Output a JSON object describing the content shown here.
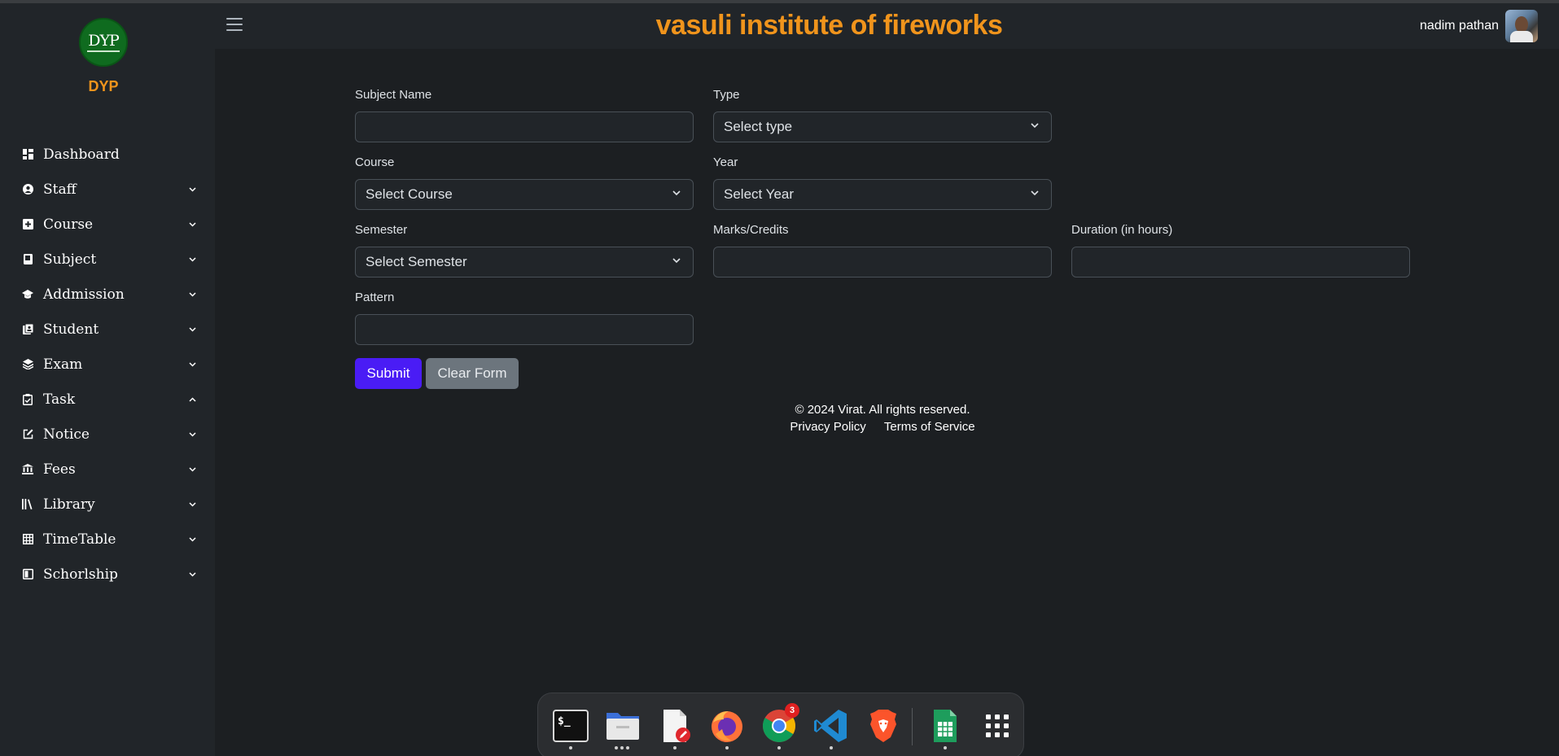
{
  "brand": {
    "logo_text": "DYP",
    "name": "DYP"
  },
  "header": {
    "site_title": "vasuli institute of fireworks",
    "user_name": "nadim pathan"
  },
  "sidebar": {
    "items": [
      {
        "label": "Dashboard",
        "icon": "dashboard-icon",
        "caret": ""
      },
      {
        "label": "Staff",
        "icon": "person-icon",
        "caret": "down"
      },
      {
        "label": "Course",
        "icon": "plus-square-icon",
        "caret": "down"
      },
      {
        "label": "Subject",
        "icon": "book-icon",
        "caret": "down"
      },
      {
        "label": "Addmission",
        "icon": "graduation-cap-icon",
        "caret": "down"
      },
      {
        "label": "Student",
        "icon": "student-list-icon",
        "caret": "down"
      },
      {
        "label": "Exam",
        "icon": "layers-icon",
        "caret": "down"
      },
      {
        "label": "Task",
        "icon": "clipboard-check-icon",
        "caret": "up"
      },
      {
        "label": "Notice",
        "icon": "edit-icon",
        "caret": "down"
      },
      {
        "label": "Fees",
        "icon": "bank-icon",
        "caret": "down"
      },
      {
        "label": "Library",
        "icon": "library-icon",
        "caret": "down"
      },
      {
        "label": "TimeTable",
        "icon": "table-icon",
        "caret": "down"
      },
      {
        "label": "Schorlship",
        "icon": "book-open-icon",
        "caret": "down"
      }
    ]
  },
  "form": {
    "subject_name_label": "Subject Name",
    "subject_name_value": "",
    "type_label": "Type",
    "type_selected": "Select type",
    "course_label": "Course",
    "course_selected": "Select Course",
    "year_label": "Year",
    "year_selected": "Select Year",
    "semester_label": "Semester",
    "semester_selected": "Select Semester",
    "marks_label": "Marks/Credits",
    "marks_value": "",
    "duration_label": "Duration (in hours)",
    "duration_value": "",
    "pattern_label": "Pattern",
    "pattern_value": "",
    "submit_label": "Submit",
    "clear_label": "Clear Form"
  },
  "footer": {
    "copyright": "© 2024 Virat. All rights reserved.",
    "privacy": "Privacy Policy",
    "terms": "Terms of Service"
  },
  "dock": {
    "apps": [
      {
        "name": "terminal-icon",
        "glyph": "$_"
      },
      {
        "name": "files-icon"
      },
      {
        "name": "text-editor-icon"
      },
      {
        "name": "firefox-icon"
      },
      {
        "name": "chrome-icon",
        "badge": "3"
      },
      {
        "name": "vscode-icon"
      },
      {
        "name": "brave-icon"
      },
      {
        "name": "spreadsheet-icon"
      },
      {
        "name": "app-grid-icon"
      }
    ]
  },
  "colors": {
    "accent_orange": "#f0941c",
    "submit_blue": "#4a1cf5",
    "clear_gray": "#6c757d",
    "background": "#1c1f22",
    "sidebar": "#212529"
  }
}
